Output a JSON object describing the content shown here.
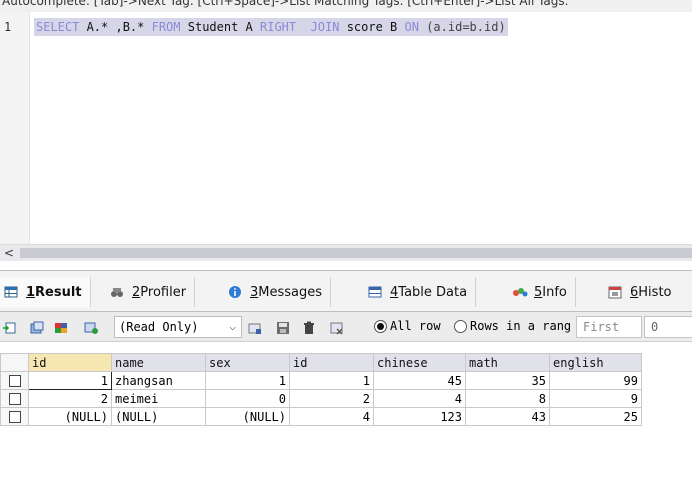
{
  "hint": {
    "text": "Autocomplete: [Tab]->Next Tag. [Ctrl+Space]->List Matching Tags. [Ctrl+Enter]->List All Tags."
  },
  "editor": {
    "line_number": "1",
    "tokens": {
      "select": "SELECT",
      "a_all": " A.* ,B.* ",
      "from": "FROM",
      "student_a": " Student A ",
      "right": "RIGHT",
      "space2": "  ",
      "join": "JOIN",
      "score_b": " score B ",
      "on": "ON",
      "cond": " (a.id=b.id)"
    }
  },
  "scroll": {
    "left_arrow": "<"
  },
  "tabs": [
    {
      "number": "1",
      "label": " Result"
    },
    {
      "number": "2",
      "label": " Profiler"
    },
    {
      "number": "3",
      "label": " Messages"
    },
    {
      "number": "4",
      "label": " Table Data"
    },
    {
      "number": "5",
      "label": " Info"
    },
    {
      "number": "6",
      "label": " Histo"
    }
  ],
  "toolbar": {
    "mode_select": "(Read Only)",
    "chevron": "⌵",
    "radio_all_rows": "All row",
    "radio_range": "Rows in a rang",
    "first_placeholder": "First",
    "first_value": "0"
  },
  "grid": {
    "columns": [
      "id",
      "name",
      "sex",
      "id",
      "chinese",
      "math",
      "english"
    ],
    "rows": [
      [
        "1",
        "zhangsan",
        "1",
        "1",
        "45",
        "35",
        "99"
      ],
      [
        "2",
        "meimei",
        "0",
        "2",
        "4",
        "8",
        "9"
      ],
      [
        "(NULL)",
        "(NULL)",
        "(NULL)",
        "4",
        "123",
        "43",
        "25"
      ]
    ]
  },
  "colors": {
    "keyword": "#8a8ad8",
    "highlight": "#d6d6e8",
    "header_bg": "#e1e1ea",
    "header_first_bg": "#f6e7b2"
  }
}
